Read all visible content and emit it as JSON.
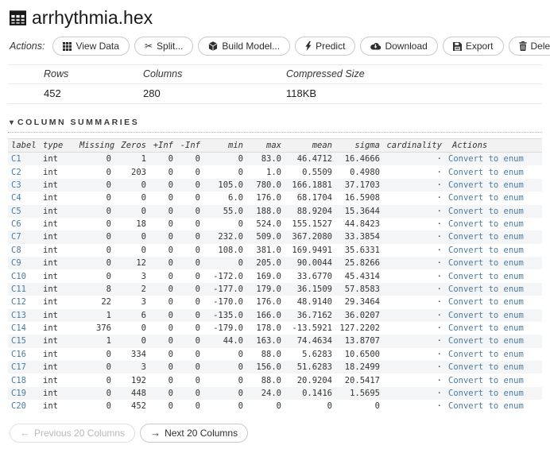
{
  "header": {
    "title": "arrhythmia.hex"
  },
  "actions": {
    "label": "Actions:",
    "buttons": [
      {
        "icon": "grid-icon",
        "label": "View Data"
      },
      {
        "icon": "scissors-icon",
        "label": "Split...",
        "icon_glyph": "✂"
      },
      {
        "icon": "cube-icon",
        "label": "Build Model..."
      },
      {
        "icon": "bolt-icon",
        "label": "Predict"
      },
      {
        "icon": "cloud-download-icon",
        "label": "Download"
      },
      {
        "icon": "floppy-icon",
        "label": "Export"
      },
      {
        "icon": "trash-icon",
        "label": "Delete"
      }
    ]
  },
  "meta": {
    "headers": {
      "rows": "Rows",
      "columns": "Columns",
      "size": "Compressed Size"
    },
    "values": {
      "rows": "452",
      "columns": "280",
      "size": "118KB"
    }
  },
  "section": {
    "caret": "▾",
    "title": "COLUMN SUMMARIES"
  },
  "table": {
    "columns": [
      "label",
      "type",
      "Missing",
      "Zeros",
      "+Inf",
      "-Inf",
      "min",
      "max",
      "mean",
      "sigma",
      "cardinality",
      "Actions"
    ],
    "action_link": "Convert to enum",
    "cardinality_placeholder": "·",
    "rows": [
      [
        "C1",
        "int",
        "0",
        "1",
        "0",
        "0",
        "0",
        "83.0",
        "46.4712",
        "16.4666",
        "·",
        "Convert to enum"
      ],
      [
        "C2",
        "int",
        "0",
        "203",
        "0",
        "0",
        "0",
        "1.0",
        "0.5509",
        "0.4980",
        "·",
        "Convert to enum"
      ],
      [
        "C3",
        "int",
        "0",
        "0",
        "0",
        "0",
        "105.0",
        "780.0",
        "166.1881",
        "37.1703",
        "·",
        "Convert to enum"
      ],
      [
        "C4",
        "int",
        "0",
        "0",
        "0",
        "0",
        "6.0",
        "176.0",
        "68.1704",
        "16.5908",
        "·",
        "Convert to enum"
      ],
      [
        "C5",
        "int",
        "0",
        "0",
        "0",
        "0",
        "55.0",
        "188.0",
        "88.9204",
        "15.3644",
        "·",
        "Convert to enum"
      ],
      [
        "C6",
        "int",
        "0",
        "18",
        "0",
        "0",
        "0",
        "524.0",
        "155.1527",
        "44.8423",
        "·",
        "Convert to enum"
      ],
      [
        "C7",
        "int",
        "0",
        "0",
        "0",
        "0",
        "232.0",
        "509.0",
        "367.2080",
        "33.3854",
        "·",
        "Convert to enum"
      ],
      [
        "C8",
        "int",
        "0",
        "0",
        "0",
        "0",
        "108.0",
        "381.0",
        "169.9491",
        "35.6331",
        "·",
        "Convert to enum"
      ],
      [
        "C9",
        "int",
        "0",
        "12",
        "0",
        "0",
        "0",
        "205.0",
        "90.0044",
        "25.8266",
        "·",
        "Convert to enum"
      ],
      [
        "C10",
        "int",
        "0",
        "3",
        "0",
        "0",
        "-172.0",
        "169.0",
        "33.6770",
        "45.4314",
        "·",
        "Convert to enum"
      ],
      [
        "C11",
        "int",
        "8",
        "2",
        "0",
        "0",
        "-177.0",
        "179.0",
        "36.1509",
        "57.8583",
        "·",
        "Convert to enum"
      ],
      [
        "C12",
        "int",
        "22",
        "3",
        "0",
        "0",
        "-170.0",
        "176.0",
        "48.9140",
        "29.3464",
        "·",
        "Convert to enum"
      ],
      [
        "C13",
        "int",
        "1",
        "6",
        "0",
        "0",
        "-135.0",
        "166.0",
        "36.7162",
        "36.0207",
        "·",
        "Convert to enum"
      ],
      [
        "C14",
        "int",
        "376",
        "0",
        "0",
        "0",
        "-179.0",
        "178.0",
        "-13.5921",
        "127.2202",
        "·",
        "Convert to enum"
      ],
      [
        "C15",
        "int",
        "1",
        "0",
        "0",
        "0",
        "44.0",
        "163.0",
        "74.4634",
        "13.8707",
        "·",
        "Convert to enum"
      ],
      [
        "C16",
        "int",
        "0",
        "334",
        "0",
        "0",
        "0",
        "88.0",
        "5.6283",
        "10.6500",
        "·",
        "Convert to enum"
      ],
      [
        "C17",
        "int",
        "0",
        "3",
        "0",
        "0",
        "0",
        "156.0",
        "51.6283",
        "18.2499",
        "·",
        "Convert to enum"
      ],
      [
        "C18",
        "int",
        "0",
        "192",
        "0",
        "0",
        "0",
        "88.0",
        "20.9204",
        "20.5417",
        "·",
        "Convert to enum"
      ],
      [
        "C19",
        "int",
        "0",
        "448",
        "0",
        "0",
        "0",
        "24.0",
        "0.1416",
        "1.5695",
        "·",
        "Convert to enum"
      ],
      [
        "C20",
        "int",
        "0",
        "452",
        "0",
        "0",
        "0",
        "0",
        "0",
        "0",
        "·",
        "Convert to enum"
      ]
    ]
  },
  "pager": {
    "prev_icon": "←",
    "prev_label": "Previous 20 Columns",
    "next_icon": "→",
    "next_label": "Next 20 Columns"
  },
  "colors": {
    "link_blue": "#4c7ba3",
    "row_stripe": "#f4f5f6",
    "header_bg": "#f2f2f2",
    "button_border": "#c9c9c9"
  }
}
